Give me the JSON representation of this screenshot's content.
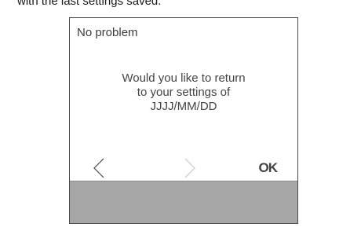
{
  "caption": {
    "text": "with the last settings saved."
  },
  "screen": {
    "title": "No problem",
    "message_lines": [
      "Would you like to return",
      "to your settings of",
      "JJJJ/MM/DD"
    ],
    "nav": {
      "prev_icon": "chevron-left-icon",
      "next_icon": "chevron-right-icon",
      "ok_label": "OK"
    },
    "colors": {
      "bottom_bar": "#a6a6a6",
      "disabled_arrow": "#cfcfcf",
      "active_arrow": "#555555"
    }
  }
}
